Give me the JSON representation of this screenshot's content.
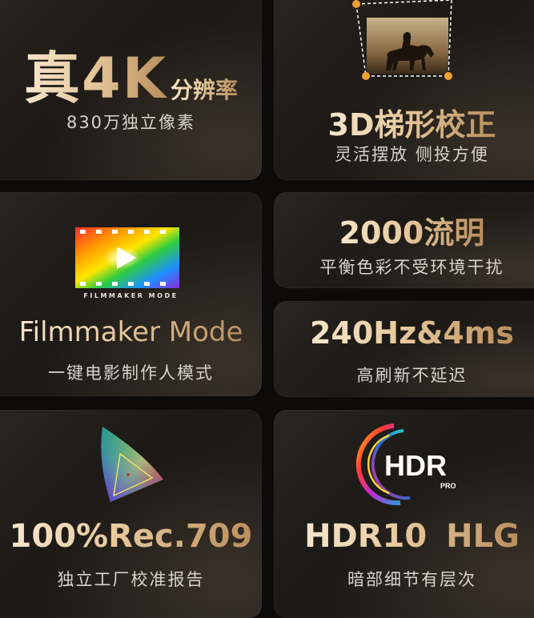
{
  "cards": {
    "fourk": {
      "big": "真4K",
      "suffix": "分辨率",
      "sub": "830万独立像素"
    },
    "keystone": {
      "title": "3D梯形校正",
      "sub": "灵活摆放 侧投方便"
    },
    "filmmaker": {
      "logo_text": "FILMMAKER MODE",
      "title": "Filmmaker Mode",
      "sub": "一键电影制作人模式"
    },
    "lumen": {
      "title": "2000流明",
      "sub": "平衡色彩不受环境干扰"
    },
    "hz": {
      "title": "240Hz&4ms",
      "sub": "高刷新不延迟"
    },
    "rec": {
      "title": "100%Rec.709",
      "sub": "独立工厂校准报告"
    },
    "hdr": {
      "logo_main": "HDR",
      "logo_sub": "PRO",
      "title": "HDR10 HLG",
      "sub": "暗部细节有层次"
    }
  },
  "colors": {
    "background": "#0d0b09",
    "card": "#1f1b18",
    "gold_light": "#f6e6cc",
    "gold_dark": "#b98e5c",
    "handle": "#f0a030"
  }
}
